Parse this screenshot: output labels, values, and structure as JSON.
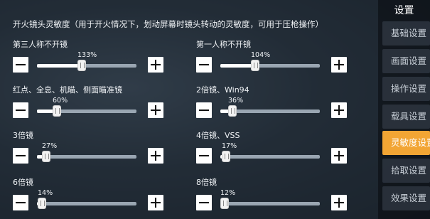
{
  "section": {
    "title": "开火镜头灵敏度（用于开火情况下，划动屏幕时镜头转动的灵敏度，可用于压枪操作）"
  },
  "sliders": [
    {
      "label": "第三人称不开镜",
      "value_text": "133%",
      "level": 0.45
    },
    {
      "label": "第一人称不开镜",
      "value_text": "104%",
      "level": 0.35
    },
    {
      "label": "红点、全息、机瞄、侧面瞄准镜",
      "value_text": "60%",
      "level": 0.2
    },
    {
      "label": "2倍镜、Win94",
      "value_text": "36%",
      "level": 0.12
    },
    {
      "label": "3倍镜",
      "value_text": "27%",
      "level": 0.09
    },
    {
      "label": "4倍镜、VSS",
      "value_text": "17%",
      "level": 0.06
    },
    {
      "label": "6倍镜",
      "value_text": "14%",
      "level": 0.05
    },
    {
      "label": "8倍镜",
      "value_text": "12%",
      "level": 0.04
    }
  ],
  "sidebar": {
    "title": "设置",
    "items": [
      {
        "label": "基础设置"
      },
      {
        "label": "画面设置"
      },
      {
        "label": "操作设置"
      },
      {
        "label": "载具设置"
      },
      {
        "label": "灵敏度设置"
      },
      {
        "label": "拾取设置"
      },
      {
        "label": "效果设置"
      }
    ],
    "active_index": 4,
    "active_color": "#f2a534"
  }
}
